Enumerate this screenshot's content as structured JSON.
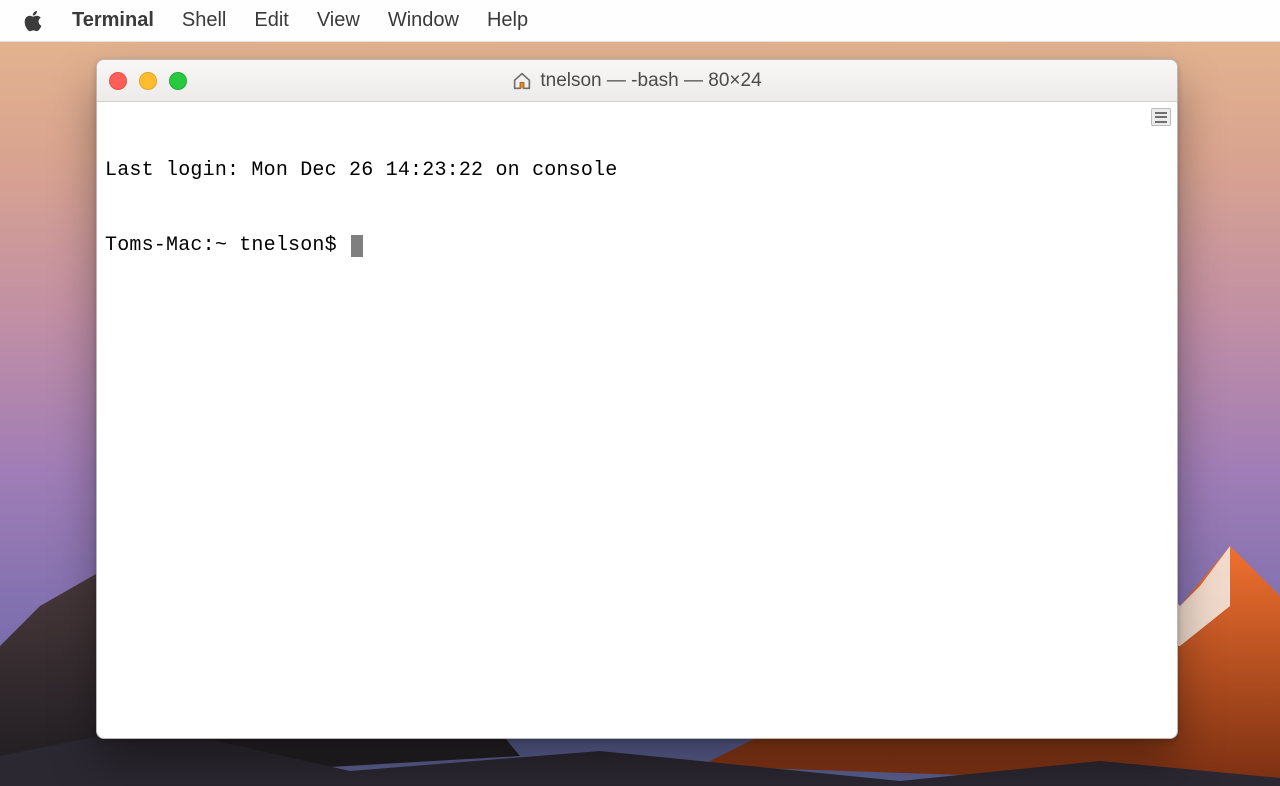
{
  "menubar": {
    "app_name": "Terminal",
    "items": [
      "Shell",
      "Edit",
      "View",
      "Window",
      "Help"
    ]
  },
  "window": {
    "title": "tnelson — -bash — 80×24",
    "traffic": {
      "close": "close",
      "minimize": "minimize",
      "zoom": "zoom"
    }
  },
  "terminal": {
    "last_login": "Last login: Mon Dec 26 14:23:22 on console",
    "prompt": "Toms-Mac:~ tnelson$ "
  }
}
